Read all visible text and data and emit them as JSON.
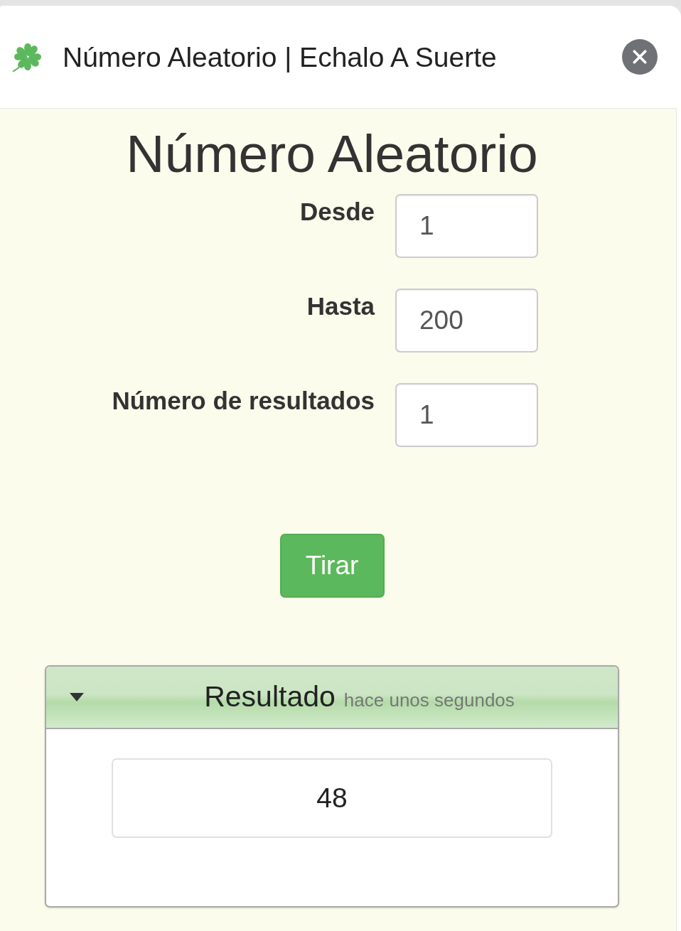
{
  "window": {
    "title": "Número Aleatorio | Echalo A Suerte"
  },
  "form": {
    "heading": "Número Aleatorio",
    "fields": [
      {
        "label": "Desde",
        "value": "1"
      },
      {
        "label": "Hasta",
        "value": "200"
      },
      {
        "label": "Número de resultados",
        "value": "1"
      }
    ],
    "submit_button": "Tirar"
  },
  "result_panel": {
    "title": "Resultado",
    "time": "hace unos segundos",
    "expanded": true,
    "results": [
      "48"
    ]
  }
}
